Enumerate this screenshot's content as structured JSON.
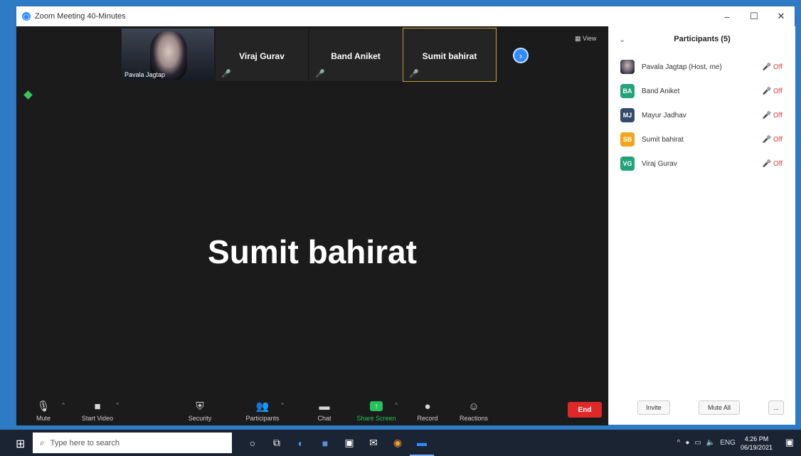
{
  "window": {
    "title": "Zoom Meeting 40-Minutes",
    "controls": [
      "–",
      "☐",
      "✕"
    ]
  },
  "stage": {
    "view_label": "View",
    "active_speaker": "Sumit bahirat",
    "thumbnails": [
      {
        "name": "Pavala Jagtap",
        "type": "photo",
        "active": false
      },
      {
        "name": "Viraj Gurav",
        "type": "name",
        "active": false
      },
      {
        "name": "Band Aniket",
        "type": "name",
        "active": false
      },
      {
        "name": "Sumit bahirat",
        "type": "name",
        "active": true
      }
    ]
  },
  "toolbar": {
    "items": [
      {
        "label": "Mute",
        "icon": "microphone-icon",
        "glyph": "🎙"
      },
      {
        "label": "Start Video",
        "icon": "video-icon",
        "glyph": "▶"
      },
      {
        "label": "Security",
        "icon": "shield-icon",
        "glyph": "⛨"
      },
      {
        "label": "Participants",
        "icon": "participants-icon",
        "glyph": "👥",
        "count": "5"
      },
      {
        "label": "Chat",
        "icon": "chat-icon",
        "glyph": "💬"
      },
      {
        "label": "Share Screen",
        "icon": "share-screen-icon",
        "glyph": "↑"
      },
      {
        "label": "Record",
        "icon": "record-icon",
        "glyph": "●"
      },
      {
        "label": "Reactions",
        "icon": "reactions-icon",
        "glyph": "☺"
      }
    ],
    "end_label": "End"
  },
  "participants_panel": {
    "title": "Participants (5)",
    "collapse_glyph": "⌄",
    "list": [
      {
        "initials": "",
        "name": "Pavala Jagtap (Host, me)",
        "color": "#6a6a6a",
        "photo": true
      },
      {
        "initials": "BA",
        "name": "Band Aniket",
        "color": "#23a37a",
        "photo": false
      },
      {
        "initials": "MJ",
        "name": "Mayur Jadhav",
        "color": "#334a6b",
        "photo": false
      },
      {
        "initials": "SB",
        "name": "Sumit bahirat",
        "color": "#f2a51a",
        "photo": false
      },
      {
        "initials": "VG",
        "name": "Viraj Gurav",
        "color": "#23a37a",
        "photo": false
      }
    ],
    "mic_glyph": "🎤̸",
    "footer": {
      "invite": "Invite",
      "mute_all": "Mute All",
      "more": "..."
    }
  },
  "taskbar": {
    "search_placeholder": "Type here to search",
    "clock_time": "4:26 PM",
    "clock_date": "06/19/2021"
  }
}
